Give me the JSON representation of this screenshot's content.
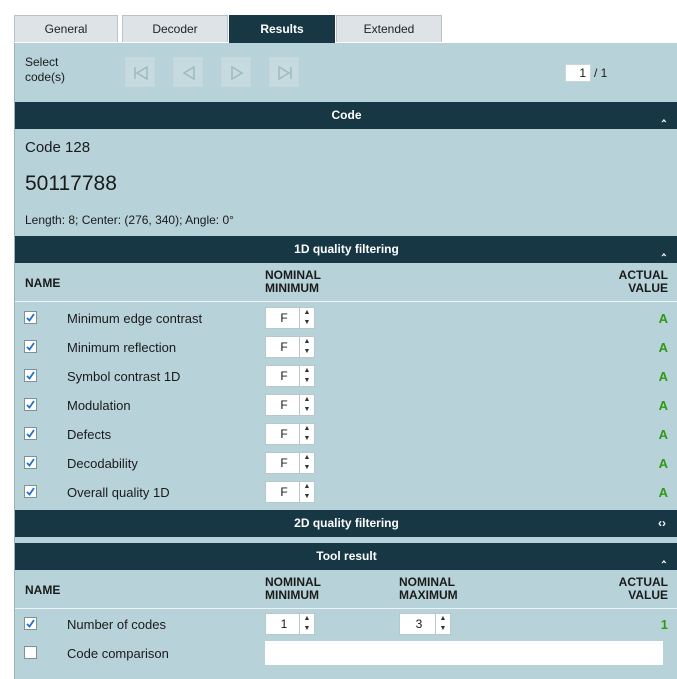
{
  "tabs": [
    "General",
    "Decoder",
    "Results",
    "Extended"
  ],
  "select": {
    "label": "Select code(s)",
    "current": "1",
    "total": "/ 1"
  },
  "code": {
    "section_title": "Code",
    "type": "Code 128",
    "value": "50117788",
    "details": "Length: 8; Center: (276, 340); Angle: 0°"
  },
  "filter1d": {
    "title": "1D quality filtering",
    "col_name": "NAME",
    "col_nominal": "NOMINAL MINIMUM",
    "col_actual": "ACTUAL VALUE",
    "rows": [
      {
        "name": "Minimum edge contrast",
        "nominal": "F",
        "actual": "A",
        "checked": true
      },
      {
        "name": "Minimum reflection",
        "nominal": "F",
        "actual": "A",
        "checked": true
      },
      {
        "name": "Symbol contrast 1D",
        "nominal": "F",
        "actual": "A",
        "checked": true
      },
      {
        "name": "Modulation",
        "nominal": "F",
        "actual": "A",
        "checked": true
      },
      {
        "name": "Defects",
        "nominal": "F",
        "actual": "A",
        "checked": true
      },
      {
        "name": "Decodability",
        "nominal": "F",
        "actual": "A",
        "checked": true
      },
      {
        "name": "Overall quality 1D",
        "nominal": "F",
        "actual": "A",
        "checked": true
      }
    ]
  },
  "filter2d": {
    "title": "2D quality filtering"
  },
  "tool": {
    "title": "Tool result",
    "col_name": "NAME",
    "col_min": "NOMINAL MINIMUM",
    "col_max": "NOMINAL MAXIMUM",
    "col_actual": "ACTUAL VALUE",
    "rows": [
      {
        "name": "Number of codes",
        "min": "1",
        "max": "3",
        "actual": "1",
        "checked": true
      },
      {
        "name": "Code comparison",
        "min": "",
        "max": "",
        "actual": "",
        "checked": false
      }
    ]
  },
  "icons": {
    "first": "skip-first-icon",
    "prev": "prev-icon",
    "next": "next-icon",
    "last": "skip-last-icon",
    "collapse": "chevron-up-double-icon",
    "expand": "chevron-down-double-icon"
  },
  "colors": {
    "header_bar": "#173745",
    "panel": "#b7d3d9",
    "grade": "#2e9a14",
    "checkbox": "#1f6fd0"
  }
}
